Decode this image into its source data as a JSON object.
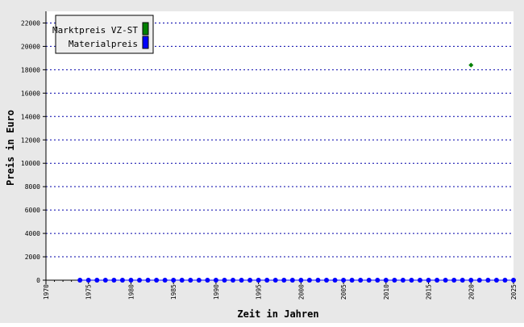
{
  "chart_data": {
    "type": "scatter",
    "xlabel": "Zeit in Jahren",
    "ylabel": "Preis in Euro",
    "xlim": [
      1970,
      2025
    ],
    "ylim": [
      0,
      23000
    ],
    "x_tick_labels": [
      "1970",
      "1975",
      "1980",
      "1985",
      "1990",
      "1995",
      "2000",
      "2005",
      "2010",
      "2015",
      "2020",
      "2025"
    ],
    "y_tick_labels": [
      "0",
      "2000",
      "4000",
      "6000",
      "8000",
      "10000",
      "12000",
      "14000",
      "16000",
      "18000",
      "20000",
      "22000"
    ],
    "grid": true,
    "legend_position": "top-left",
    "series": [
      {
        "name": "Marktpreis VZ-ST",
        "color": "#008000",
        "marker": "diamond",
        "points": [
          {
            "x": 2020,
            "y": 18400
          }
        ]
      },
      {
        "name": "Materialpreis",
        "color": "#0000ff",
        "marker": "circle",
        "line": true,
        "points": [
          {
            "x": 1974,
            "y": 0
          },
          {
            "x": 1975,
            "y": 0
          },
          {
            "x": 1976,
            "y": 0
          },
          {
            "x": 1977,
            "y": 0
          },
          {
            "x": 1978,
            "y": 0
          },
          {
            "x": 1979,
            "y": 0
          },
          {
            "x": 1980,
            "y": 0
          },
          {
            "x": 1981,
            "y": 0
          },
          {
            "x": 1982,
            "y": 0
          },
          {
            "x": 1983,
            "y": 0
          },
          {
            "x": 1984,
            "y": 0
          },
          {
            "x": 1985,
            "y": 0
          },
          {
            "x": 1986,
            "y": 0
          },
          {
            "x": 1987,
            "y": 0
          },
          {
            "x": 1988,
            "y": 0
          },
          {
            "x": 1989,
            "y": 0
          },
          {
            "x": 1990,
            "y": 0
          },
          {
            "x": 1991,
            "y": 0
          },
          {
            "x": 1992,
            "y": 0
          },
          {
            "x": 1993,
            "y": 0
          },
          {
            "x": 1994,
            "y": 0
          },
          {
            "x": 1995,
            "y": 0
          },
          {
            "x": 1996,
            "y": 0
          },
          {
            "x": 1997,
            "y": 0
          },
          {
            "x": 1998,
            "y": 0
          },
          {
            "x": 1999,
            "y": 0
          },
          {
            "x": 2000,
            "y": 0
          },
          {
            "x": 2001,
            "y": 0
          },
          {
            "x": 2002,
            "y": 0
          },
          {
            "x": 2003,
            "y": 0
          },
          {
            "x": 2004,
            "y": 0
          },
          {
            "x": 2005,
            "y": 0
          },
          {
            "x": 2006,
            "y": 0
          },
          {
            "x": 2007,
            "y": 0
          },
          {
            "x": 2008,
            "y": 0
          },
          {
            "x": 2009,
            "y": 0
          },
          {
            "x": 2010,
            "y": 0
          },
          {
            "x": 2011,
            "y": 0
          },
          {
            "x": 2012,
            "y": 0
          },
          {
            "x": 2013,
            "y": 0
          },
          {
            "x": 2014,
            "y": 0
          },
          {
            "x": 2015,
            "y": 0
          },
          {
            "x": 2016,
            "y": 0
          },
          {
            "x": 2017,
            "y": 0
          },
          {
            "x": 2018,
            "y": 0
          },
          {
            "x": 2019,
            "y": 0
          },
          {
            "x": 2020,
            "y": 0
          },
          {
            "x": 2021,
            "y": 0
          },
          {
            "x": 2022,
            "y": 0
          },
          {
            "x": 2023,
            "y": 0
          },
          {
            "x": 2024,
            "y": 0
          },
          {
            "x": 2025,
            "y": 0
          }
        ]
      }
    ],
    "colors": {
      "outer_background": "#e8e8e8",
      "plot_background": "#ffffff",
      "grid": "#0000aa",
      "legend_background": "#eeeeee"
    }
  }
}
